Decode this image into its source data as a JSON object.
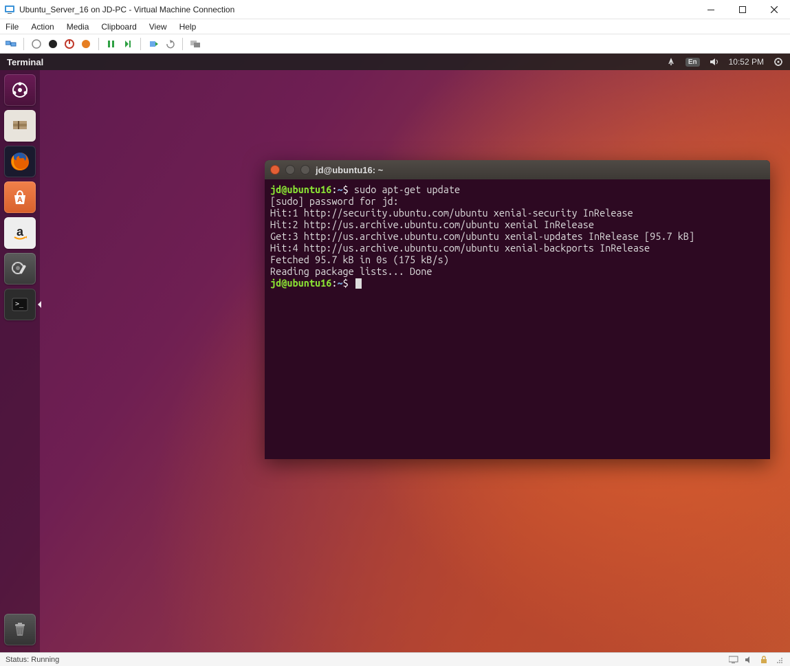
{
  "win": {
    "title": "Ubuntu_Server_16 on JD-PC - Virtual Machine Connection",
    "menu": [
      "File",
      "Action",
      "Media",
      "Clipboard",
      "View",
      "Help"
    ]
  },
  "ubuntu": {
    "panel": {
      "app": "Terminal",
      "lang": "En",
      "time": "10:52 PM"
    },
    "launcher": [
      {
        "name": "dash-icon"
      },
      {
        "name": "files-icon"
      },
      {
        "name": "firefox-icon"
      },
      {
        "name": "software-center-icon"
      },
      {
        "name": "amazon-icon"
      },
      {
        "name": "settings-icon"
      },
      {
        "name": "terminal-icon"
      }
    ]
  },
  "terminal": {
    "title": "jd@ubuntu16: ~",
    "prompt_user": "jd@ubuntu16",
    "prompt_path": "~",
    "prompt_symbol": "$",
    "cmd1": "sudo apt-get update",
    "lines": [
      "[sudo] password for jd:",
      "Hit:1 http://security.ubuntu.com/ubuntu xenial-security InRelease",
      "Hit:2 http://us.archive.ubuntu.com/ubuntu xenial InRelease",
      "Get:3 http://us.archive.ubuntu.com/ubuntu xenial-updates InRelease [95.7 kB]",
      "Hit:4 http://us.archive.ubuntu.com/ubuntu xenial-backports InRelease",
      "Fetched 95.7 kB in 0s (175 kB/s)",
      "Reading package lists... Done"
    ]
  },
  "status": {
    "text": "Status: Running"
  }
}
